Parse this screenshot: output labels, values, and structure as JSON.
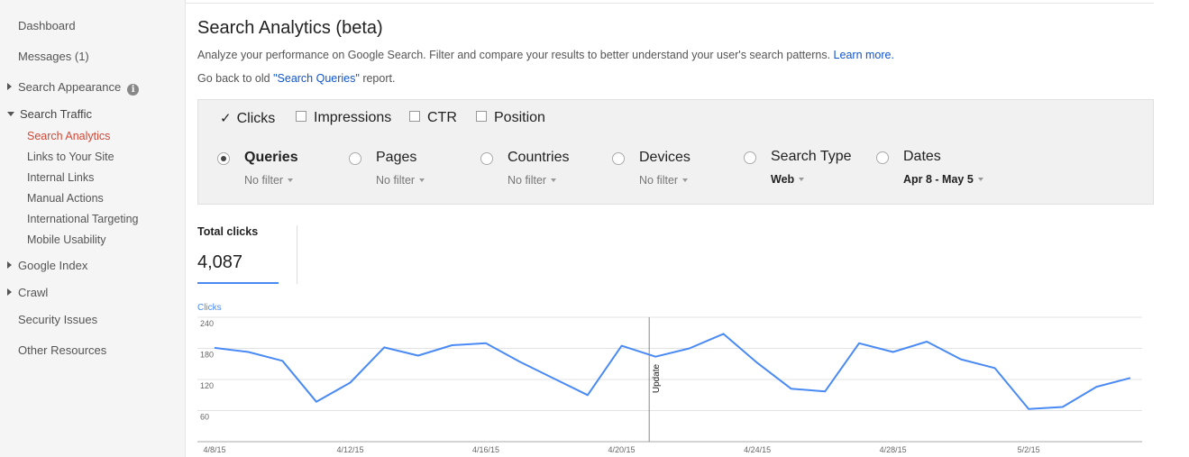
{
  "sidebar": {
    "dashboard": "Dashboard",
    "messages": "Messages (1)",
    "search_appearance": "Search Appearance",
    "search_traffic": "Search Traffic",
    "search_traffic_items": [
      "Search Analytics",
      "Links to Your Site",
      "Internal Links",
      "Manual Actions",
      "International Targeting",
      "Mobile Usability"
    ],
    "google_index": "Google Index",
    "crawl": "Crawl",
    "security_issues": "Security Issues",
    "other_resources": "Other Resources",
    "info_glyph": "i"
  },
  "main": {
    "title": "Search Analytics (beta)",
    "description": "Analyze your performance on Google Search. Filter and compare your results to better understand your user's search patterns.",
    "learn_more": "Learn more.",
    "old_prefix": "Go back to old",
    "old_link": "\"Search Queries\"",
    "old_suffix": "report."
  },
  "metrics": {
    "clicks": "Clicks",
    "impressions": "Impressions",
    "ctr": "CTR",
    "position": "Position",
    "check_glyph": "✓"
  },
  "dimensions": {
    "queries": {
      "label": "Queries",
      "filter": "No filter"
    },
    "pages": {
      "label": "Pages",
      "filter": "No filter"
    },
    "countries": {
      "label": "Countries",
      "filter": "No filter"
    },
    "devices": {
      "label": "Devices",
      "filter": "No filter"
    },
    "search_type": {
      "label": "Search Type",
      "filter": "Web"
    },
    "dates": {
      "label": "Dates",
      "filter": "Apr 8 - May 5"
    }
  },
  "totals": {
    "label": "Total clicks",
    "value": "4,087"
  },
  "colors": {
    "accent": "#4a8af4",
    "active_nav": "#d14836",
    "link": "#1155cc"
  },
  "chart_data": {
    "type": "line",
    "ylabel": "Clicks",
    "ylim": [
      0,
      240
    ],
    "yticks": [
      60,
      120,
      180,
      240
    ],
    "x": [
      "4/8/15",
      "4/9/15",
      "4/10/15",
      "4/11/15",
      "4/12/15",
      "4/13/15",
      "4/14/15",
      "4/15/15",
      "4/16/15",
      "4/17/15",
      "4/18/15",
      "4/19/15",
      "4/20/15",
      "4/21/15",
      "4/22/15",
      "4/23/15",
      "4/24/15",
      "4/25/15",
      "4/26/15",
      "4/27/15",
      "4/28/15",
      "4/29/15",
      "4/30/15",
      "5/1/15",
      "5/2/15",
      "5/3/15",
      "5/4/15",
      "5/5/15"
    ],
    "xtick_labels": [
      "4/8/15",
      "4/12/15",
      "4/16/15",
      "4/20/15",
      "4/24/15",
      "4/28/15",
      "5/2/15"
    ],
    "series": [
      {
        "name": "Clicks",
        "values": [
          181,
          173,
          156,
          77,
          114,
          182,
          166,
          186,
          190,
          154,
          122,
          90,
          185,
          164,
          180,
          208,
          152,
          102,
          97,
          190,
          173,
          193,
          159,
          142,
          63,
          67,
          106,
          123
        ]
      }
    ],
    "annotations": [
      {
        "x": "4/21/15",
        "label": "Update"
      }
    ],
    "grid": true
  }
}
